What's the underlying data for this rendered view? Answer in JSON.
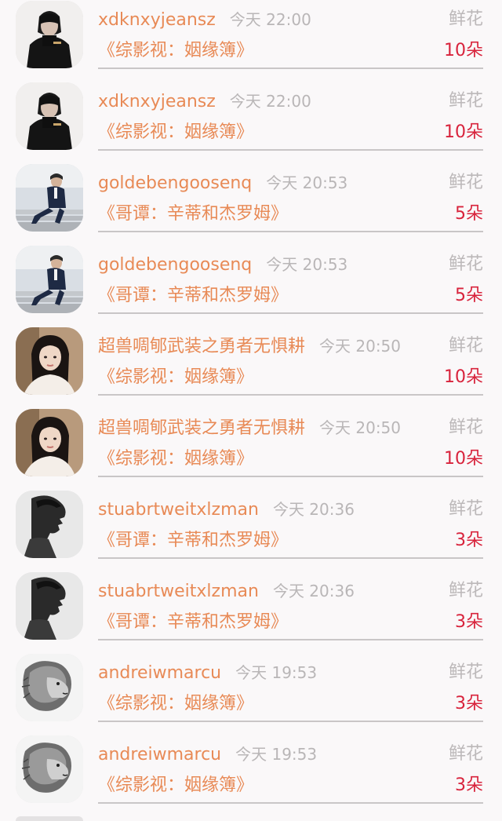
{
  "colors": {
    "background": "#faf8f9",
    "username": "#e88a56",
    "time": "#b9b6b7",
    "gift_type": "#bcb8b9",
    "book_title": "#e88a56",
    "count": "#d8233c",
    "separator": "#c9c6c7"
  },
  "rows": [
    {
      "username": "xdknxyjeansz",
      "time": "今天 22:00",
      "gift_type": "鲜花",
      "book": "《综影视：姻缘簿》",
      "count": "10朵",
      "avatar_icon": "avatar-person-black-clothes-icon"
    },
    {
      "username": "xdknxyjeansz",
      "time": "今天 22:00",
      "gift_type": "鲜花",
      "book": "《综影视：姻缘簿》",
      "count": "10朵",
      "avatar_icon": "avatar-person-black-clothes-icon"
    },
    {
      "username": "goldebengoosenq",
      "time": "今天 20:53",
      "gift_type": "鲜花",
      "book": "《哥谭：辛蒂和杰罗姆》",
      "count": "5朵",
      "avatar_icon": "avatar-man-suit-on-steps-icon"
    },
    {
      "username": "goldebengoosenq",
      "time": "今天 20:53",
      "gift_type": "鲜花",
      "book": "《哥谭：辛蒂和杰罗姆》",
      "count": "5朵",
      "avatar_icon": "avatar-man-suit-on-steps-icon"
    },
    {
      "username": "超兽啁郇武装之勇者无惧耕",
      "time": "今天 20:50",
      "gift_type": "鲜花",
      "book": "《综影视：姻缘簿》",
      "count": "10朵",
      "avatar_icon": "avatar-woman-long-hair-icon"
    },
    {
      "username": "超兽啁郇武装之勇者无惧耕",
      "time": "今天 20:50",
      "gift_type": "鲜花",
      "book": "《综影视：姻缘簿》",
      "count": "10朵",
      "avatar_icon": "avatar-woman-long-hair-icon"
    },
    {
      "username": "stuabrtweitxlzman",
      "time": "今天 20:36",
      "gift_type": "鲜花",
      "book": "《哥谭：辛蒂和杰罗姆》",
      "count": "3朵",
      "avatar_icon": "avatar-man-profile-bw-icon"
    },
    {
      "username": "stuabrtweitxlzman",
      "time": "今天 20:36",
      "gift_type": "鲜花",
      "book": "《哥谭：辛蒂和杰罗姆》",
      "count": "3朵",
      "avatar_icon": "avatar-man-profile-bw-icon"
    },
    {
      "username": "andreiwmarcu",
      "time": "今天 19:53",
      "gift_type": "鲜花",
      "book": "《综影视：姻缘簿》",
      "count": "3朵",
      "avatar_icon": "avatar-lion-sketch-icon"
    },
    {
      "username": "andreiwmarcu",
      "time": "今天 19:53",
      "gift_type": "鲜花",
      "book": "《综影视：姻缘簿》",
      "count": "3朵",
      "avatar_icon": "avatar-lion-sketch-icon"
    }
  ]
}
